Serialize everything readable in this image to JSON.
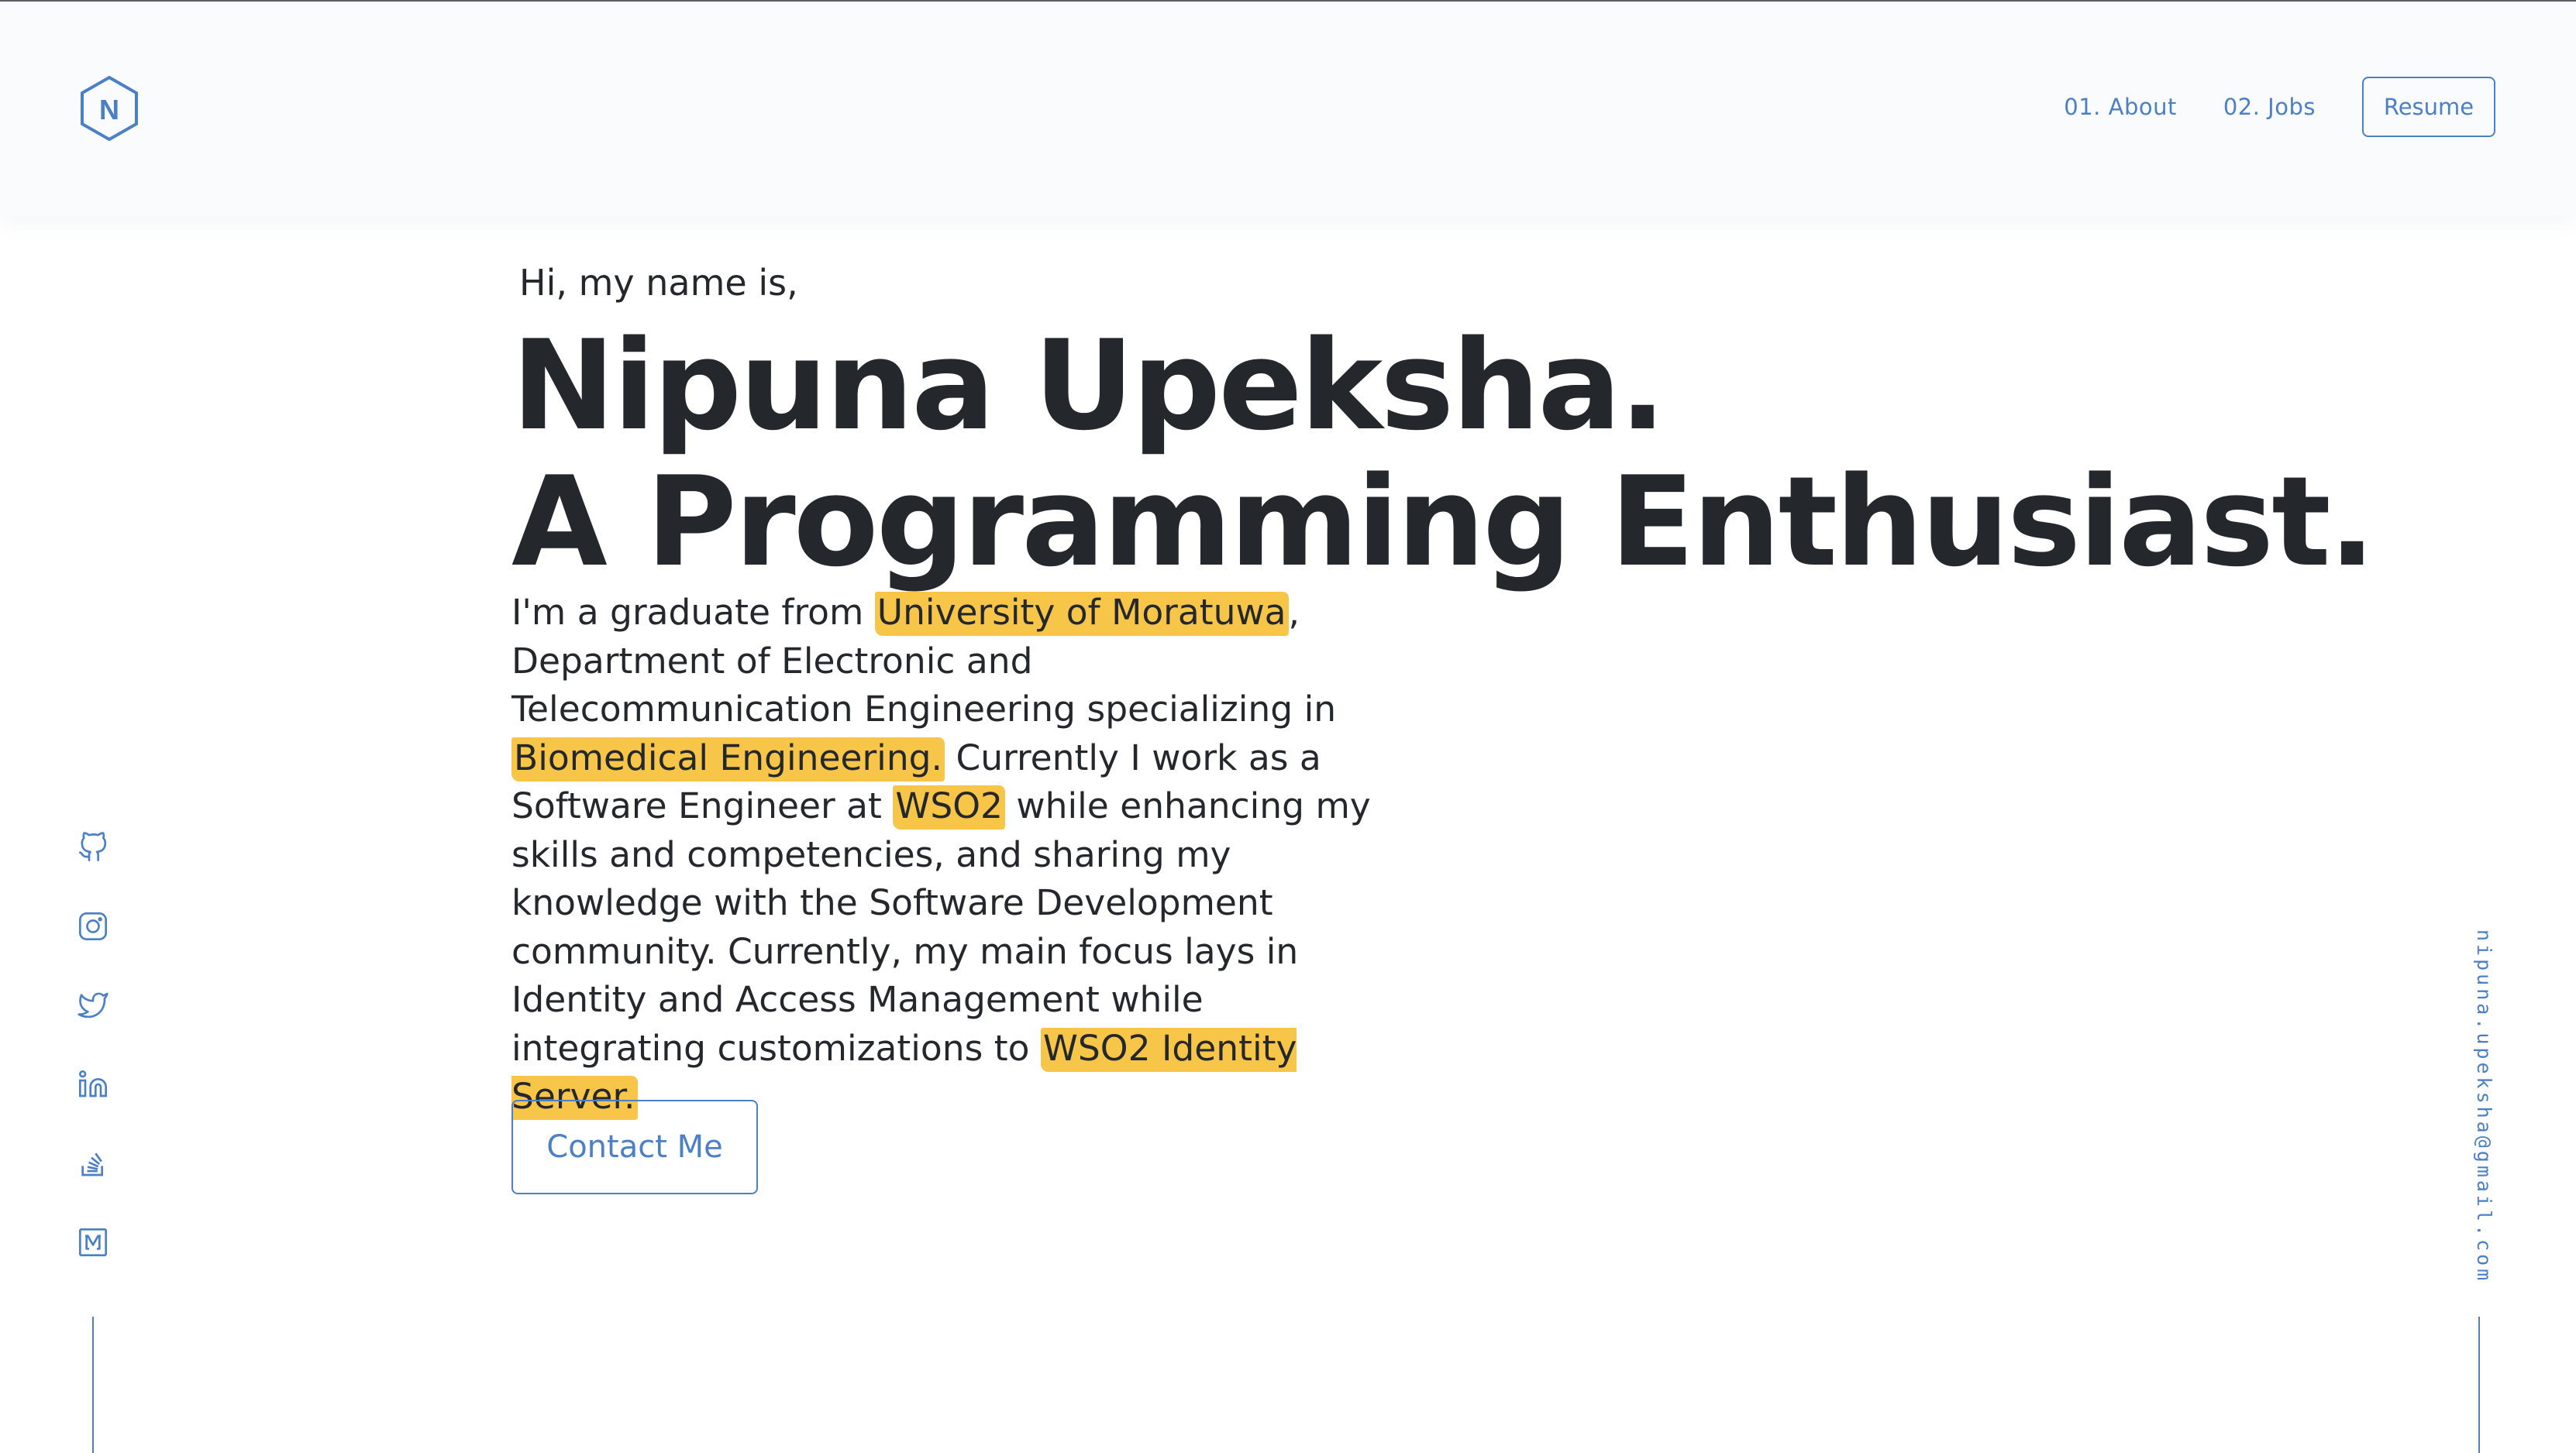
{
  "header": {
    "logo_letter": "N",
    "nav": [
      {
        "label": "01. About"
      },
      {
        "label": "02. Jobs"
      }
    ],
    "resume_label": "Resume"
  },
  "hero": {
    "greeting": "Hi, my name is,",
    "name": "Nipuna Upeksha.",
    "tagline": "A Programming Enthusiast.",
    "bio": {
      "t1": "I'm a graduate from ",
      "h1": "University of Moratuwa",
      "t2": ", Department of Electronic and Telecommunication Engineering specializing in ",
      "h2": "Biomedical Engineering.",
      "t3": " Currently I work as a Software Engineer at ",
      "h3": "WSO2",
      "t4": " while enhancing my skills and competencies, and sharing my knowledge with the Software Development community. Currently, my main focus lays in Identity and Access Management while integrating customizations to ",
      "h4": "WSO2 Identity Server."
    },
    "contact_label": "Contact Me"
  },
  "social": [
    {
      "icon": "github-icon"
    },
    {
      "icon": "instagram-icon"
    },
    {
      "icon": "twitter-icon"
    },
    {
      "icon": "linkedin-icon"
    },
    {
      "icon": "stackoverflow-icon"
    },
    {
      "icon": "medium-icon"
    }
  ],
  "email": "nipuna.upeksha@gmail.com",
  "colors": {
    "accent": "#4b7fc6",
    "highlight": "#f7c548",
    "text": "#24272c"
  }
}
